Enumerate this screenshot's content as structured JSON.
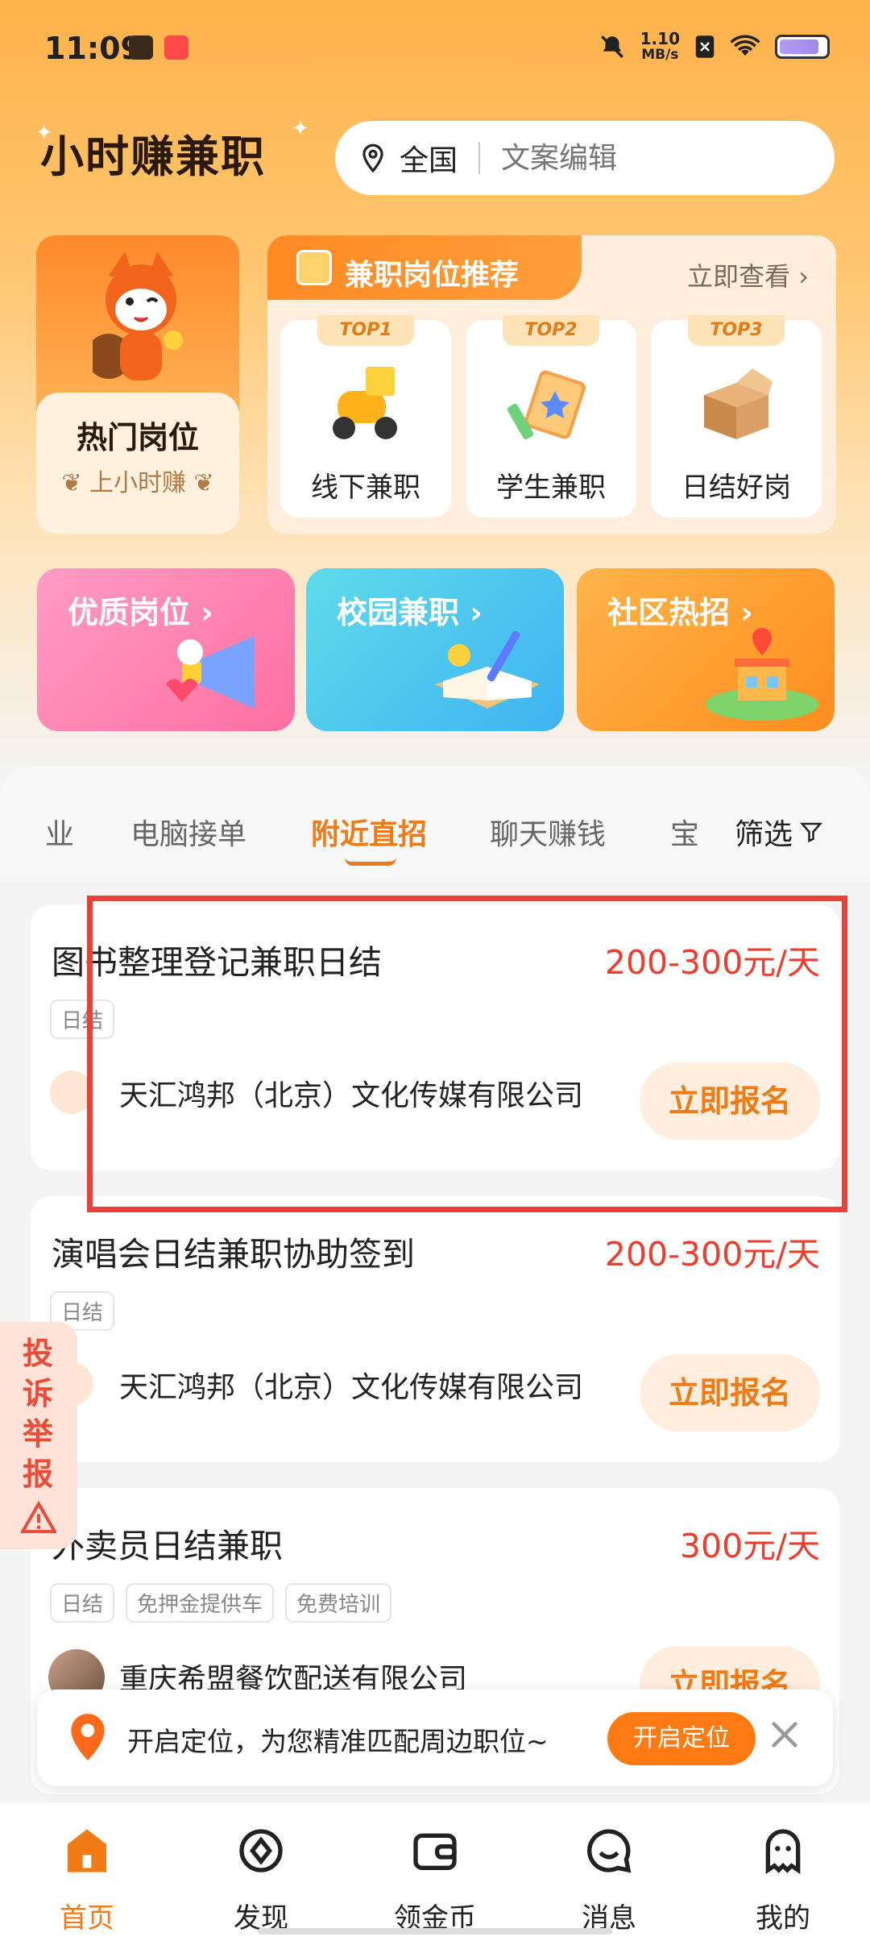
{
  "status_bar": {
    "time": "11:09",
    "net_speed_top": "1.10",
    "net_speed_bottom": "MB/s"
  },
  "header": {
    "app_name": "小时赚兼职",
    "region": "全国",
    "search_placeholder": "文案编辑"
  },
  "hot_card": {
    "title": "热门岗位",
    "subtitle": "上小时赚"
  },
  "recommend": {
    "title": "兼职岗位推荐",
    "more_label": "立即查看",
    "items": [
      {
        "badge": "TOP1",
        "label": "线下兼职"
      },
      {
        "badge": "TOP2",
        "label": "学生兼职"
      },
      {
        "badge": "TOP3",
        "label": "日结好岗"
      }
    ]
  },
  "promos": [
    {
      "title": "优质岗位",
      "color_from": "#ff88b8",
      "color_to": "#ff6fa0"
    },
    {
      "title": "校园兼职",
      "color_from": "#4fd0ea",
      "color_to": "#3fb3f2"
    },
    {
      "title": "社区热招",
      "color_from": "#ffab3f",
      "color_to": "#ff8d1e"
    }
  ],
  "tabs": {
    "items": [
      "业",
      "电脑接单",
      "附近直招",
      "聊天赚钱",
      "宝"
    ],
    "active": "附近直招",
    "filter_label": "筛选"
  },
  "jobs": [
    {
      "title": "图书整理登记兼职日结",
      "salary": "200-300元/天",
      "tags": [
        "日结"
      ],
      "company": "天汇鸿邦（北京）文化传媒有限公司",
      "apply_label": "立即报名"
    },
    {
      "title": "演唱会日结兼职协助签到",
      "salary": "200-300元/天",
      "tags": [
        "日结"
      ],
      "company": "天汇鸿邦（北京）文化传媒有限公司",
      "apply_label": "立即报名"
    },
    {
      "title": "外卖员日结兼职",
      "salary": "300元/天",
      "tags": [
        "日结",
        "免押金提供车",
        "免费培训"
      ],
      "company": "重庆希盟餐饮配送有限公司",
      "apply_label": "立即报名"
    }
  ],
  "complaint": {
    "label": "投诉举报"
  },
  "location_bar": {
    "text": "开启定位，为您精准匹配周边职位~",
    "button_label": "开启定位"
  },
  "bottom_nav": {
    "items": [
      {
        "label": "首页",
        "icon": "home-icon",
        "active": true
      },
      {
        "label": "发现",
        "icon": "compass-icon",
        "active": false
      },
      {
        "label": "领金币",
        "icon": "wallet-icon",
        "active": false
      },
      {
        "label": "消息",
        "icon": "chat-icon",
        "active": false
      },
      {
        "label": "我的",
        "icon": "ghost-profile-icon",
        "active": false
      }
    ]
  },
  "colors": {
    "accent": "#f07a13",
    "salary": "#ef3c2d",
    "highlight_border": "#e8403b"
  }
}
